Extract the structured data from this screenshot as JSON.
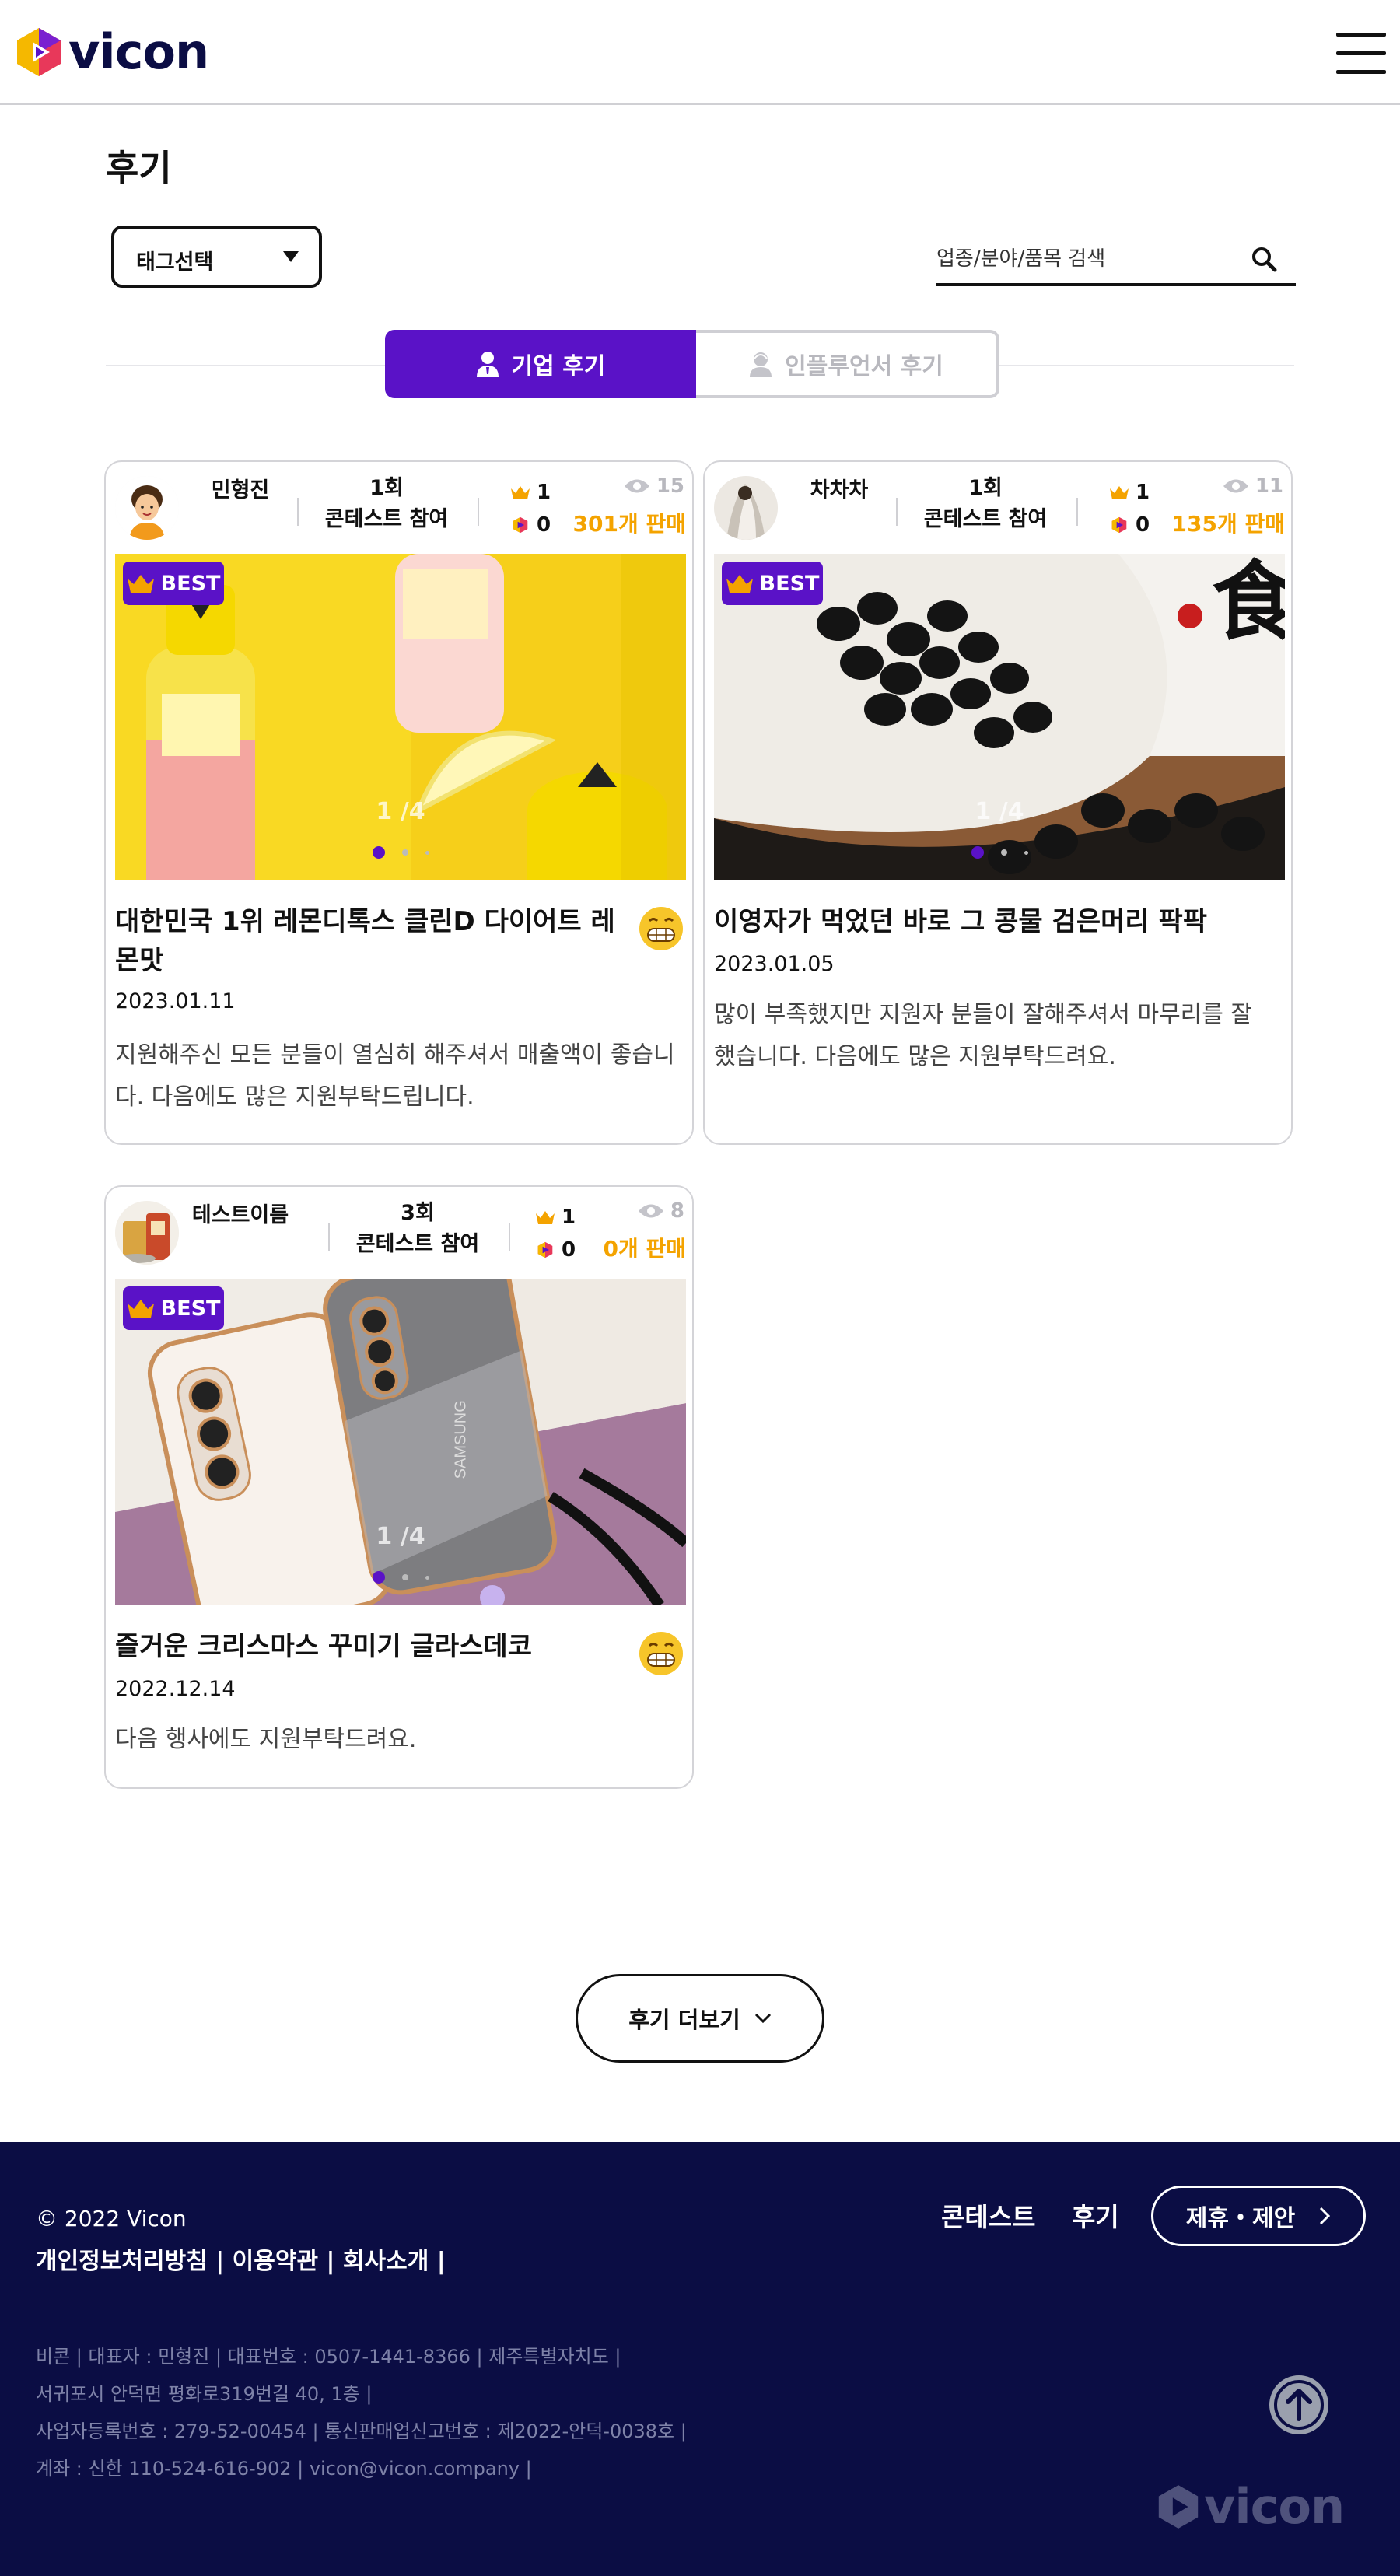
{
  "brand": {
    "logo_text": "vicon",
    "logo_color": "#0b0d44",
    "accent": "#5a12c7",
    "sales_color": "#f4a300"
  },
  "page": {
    "title": "후기"
  },
  "filters": {
    "tag_select_label": "태그선택",
    "search_placeholder": "업종/분야/품목 검색"
  },
  "tabs": [
    {
      "label": "기업 후기",
      "active": true,
      "icon": "person-icon"
    },
    {
      "label": "인플루언서 후기",
      "active": false,
      "icon": "influencer-icon"
    }
  ],
  "reviews": [
    {
      "name": "민형진",
      "contest_count": "1회",
      "contest_label": "콘테스트 참여",
      "crown_count": "1",
      "play_count": "0",
      "views": "15",
      "sales": "301개 판매",
      "best_label": "BEST",
      "image_counter": "1 /4",
      "title": "대한민국 1위 레몬디톡스 클린D 다이어트 레몬맛",
      "date": "2023.01.11",
      "text": "지원해주신 모든 분들이 열심히 해주셔서 매출액이 좋습니다. 다음에도 많은 지원부탁드립니다.",
      "emoji": "grinning-face-icon"
    },
    {
      "name": "차차차",
      "contest_count": "1회",
      "contest_label": "콘테스트 참여",
      "crown_count": "1",
      "play_count": "0",
      "views": "11",
      "sales": "135개 판매",
      "best_label": "BEST",
      "image_counter": "1 /4",
      "title": "이영자가 먹었던 바로 그 콩물 검은머리 팍팍",
      "date": "2023.01.05",
      "text": "많이 부족했지만 지원자 분들이 잘해주셔서 마무리를 잘 했습니다. 다음에도 많은 지원부탁드려요.",
      "image_caption": "食"
    },
    {
      "name": "테스트이름",
      "contest_count": "3회",
      "contest_label": "콘테스트 참여",
      "crown_count": "1",
      "play_count": "0",
      "views": "8",
      "sales": "0개 판매",
      "best_label": "BEST",
      "image_counter": "1 /4",
      "title": "즐거운 크리스마스 꾸미기 글라스데코",
      "date": "2022.12.14",
      "text": "다음 행사에도 지원부탁드려요.",
      "emoji": "grinning-face-icon",
      "phone_brand": "SAMSUNG"
    }
  ],
  "more_button_label": "후기 더보기",
  "footer": {
    "copyright": "© 2022 Vicon",
    "links": "개인정보처리방침 | 이용약관 | 회사소개 |",
    "info_lines": [
      "비콘 | 대표자 : 민형진 | 대표번호 : 0507-1441-8366 | 제주특별자치도 |",
      "서귀포시 안덕면 평화로319번길 40, 1층 |",
      "사업자등록번호 : 279-52-00454 | 통신판매업신고번호 : 제2022-안덕-0038호 |",
      "계좌 : 신한 110-524-616-902 | vicon@vicon.company |"
    ],
    "nav": [
      "콘테스트",
      "후기"
    ],
    "partner_label": "제휴・제안",
    "logo_text": "vicon"
  }
}
